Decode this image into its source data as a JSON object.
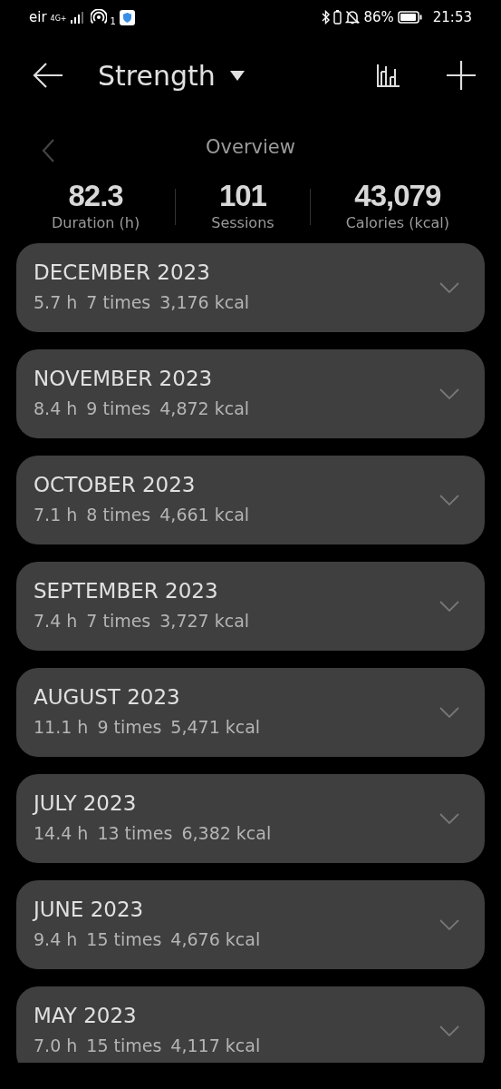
{
  "status_bar": {
    "carrier": "eir",
    "network": "4G+",
    "hotspot_count": "1",
    "battery_percent": "86%",
    "time": "21:53"
  },
  "header": {
    "title": "Strength"
  },
  "overview": {
    "title": "Overview"
  },
  "stats": [
    {
      "value": "82.3",
      "label": "Duration (h)"
    },
    {
      "value": "101",
      "label": "Sessions"
    },
    {
      "value": "43,079",
      "label": "Calories (kcal)"
    }
  ],
  "months": [
    {
      "title": "DECEMBER 2023",
      "duration": "5.7 h",
      "sessions": "7 times",
      "calories": "3,176 kcal",
      "expanded": false
    },
    {
      "title": "NOVEMBER 2023",
      "duration": "8.4 h",
      "sessions": "9 times",
      "calories": "4,872 kcal",
      "expanded": false
    },
    {
      "title": "OCTOBER 2023",
      "duration": "7.1 h",
      "sessions": "8 times",
      "calories": "4,661 kcal",
      "expanded": false
    },
    {
      "title": "SEPTEMBER 2023",
      "duration": "7.4 h",
      "sessions": "7 times",
      "calories": "3,727 kcal",
      "expanded": false
    },
    {
      "title": "AUGUST 2023",
      "duration": "11.1 h",
      "sessions": "9 times",
      "calories": "5,471 kcal",
      "expanded": false
    },
    {
      "title": "JULY 2023",
      "duration": "14.4 h",
      "sessions": "13 times",
      "calories": "6,382 kcal",
      "expanded": false
    },
    {
      "title": "JUNE 2023",
      "duration": "9.4 h",
      "sessions": "15 times",
      "calories": "4,676 kcal",
      "expanded": false
    },
    {
      "title": "MAY 2023",
      "duration": "7.0 h",
      "sessions": "15 times",
      "calories": "4,117 kcal",
      "expanded": false
    }
  ]
}
